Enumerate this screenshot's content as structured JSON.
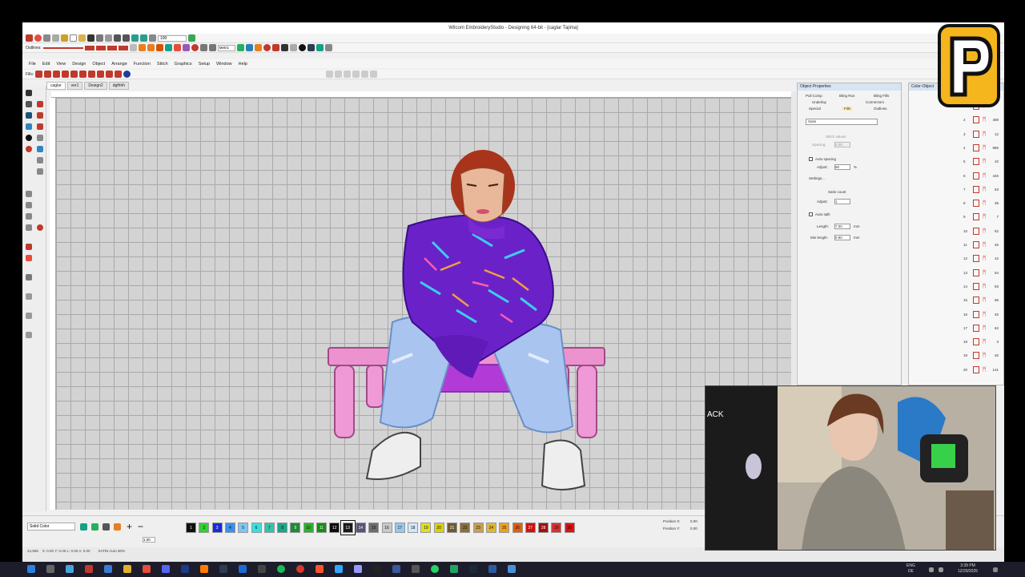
{
  "window": {
    "title": "Wilcom EmbroideryStudio - Designing 64-bit - [caglar     Tajima]"
  },
  "toolbar": {
    "outlines_label": "Outlines:",
    "fills_label": "Fills:",
    "metric_value": "Metric",
    "zoom_value": "100"
  },
  "menu": [
    "File",
    "Edit",
    "View",
    "Design",
    "Object",
    "Arrange",
    "Function",
    "Stitch",
    "Graphics",
    "Setup",
    "Window",
    "Help"
  ],
  "tabs": [
    "caglar",
    "ver1",
    "Design2",
    "dgfhhh"
  ],
  "object_properties": {
    "title": "Object Properties",
    "tabs_row1": [
      "Pull Comp",
      "Bling Run",
      "Bling Fills"
    ],
    "tabs_row2": [
      "Underlay",
      "Connectors"
    ],
    "tabs_row3": [
      "Special",
      "Fills",
      "Outlines"
    ],
    "fill_type": "Satin",
    "stitch_values_label": "Stitch values",
    "spacing_label": "Spacing:",
    "spacing_value": "0.38",
    "auto_spacing_label": "Auto spacing",
    "adjust_label": "Adjust:",
    "adjust_value": "90",
    "adjust_unit": "%",
    "settings_label": "Settings...",
    "satin_count_label": "Satin count",
    "satin_adjust_value": "1",
    "auto_split_label": "Auto split",
    "length_label": "Length:",
    "length_value": "7.00",
    "min_length_label": "Min length:",
    "min_length_value": "0.90",
    "unit_mm": "mm"
  },
  "color_object_list": {
    "title": "Color-Object",
    "rows": [
      {
        "n": "1",
        "count": ""
      },
      {
        "n": "2",
        "count": "488"
      },
      {
        "n": "3",
        "count": "12"
      },
      {
        "n": "4",
        "count": "986"
      },
      {
        "n": "5",
        "count": "10"
      },
      {
        "n": "6",
        "count": "445"
      },
      {
        "n": "7",
        "count": "63"
      },
      {
        "n": "8",
        "count": "35"
      },
      {
        "n": "9",
        "count": "7"
      },
      {
        "n": "10",
        "count": "62"
      },
      {
        "n": "11",
        "count": "46"
      },
      {
        "n": "12",
        "count": "42"
      },
      {
        "n": "13",
        "count": "54"
      },
      {
        "n": "14",
        "count": "83"
      },
      {
        "n": "15",
        "count": "96"
      },
      {
        "n": "16",
        "count": "40"
      },
      {
        "n": "17",
        "count": "62"
      },
      {
        "n": "18",
        "count": "3"
      },
      {
        "n": "19",
        "count": "40"
      },
      {
        "n": "20",
        "count": "141"
      }
    ]
  },
  "palette": {
    "mode_label": "Solid Color",
    "chips": [
      {
        "n": "1",
        "color": "#111111"
      },
      {
        "n": "2",
        "color": "#2fd12f"
      },
      {
        "n": "3",
        "color": "#1a2bd8"
      },
      {
        "n": "4",
        "color": "#3a8ff0"
      },
      {
        "n": "5",
        "color": "#7fc6f0"
      },
      {
        "n": "6",
        "color": "#39e0e0"
      },
      {
        "n": "7",
        "color": "#34c3a8"
      },
      {
        "n": "8",
        "color": "#1aa68b"
      },
      {
        "n": "9",
        "color": "#1f8a3a"
      },
      {
        "n": "10",
        "color": "#2bb12b"
      },
      {
        "n": "11",
        "color": "#148f14"
      },
      {
        "n": "12",
        "color": "#0c0c0c"
      },
      {
        "n": "13",
        "color": "#1a1a1a"
      },
      {
        "n": "14",
        "color": "#555577"
      },
      {
        "n": "15",
        "color": "#6d6d6d"
      },
      {
        "n": "16",
        "color": "#c9c9c9"
      },
      {
        "n": "17",
        "color": "#96c8f0"
      },
      {
        "n": "18",
        "color": "#d0e8f8"
      },
      {
        "n": "19",
        "color": "#e0e020"
      },
      {
        "n": "20",
        "color": "#d8d010"
      },
      {
        "n": "21",
        "color": "#6e5a32"
      },
      {
        "n": "22",
        "color": "#8c6e3c"
      },
      {
        "n": "23",
        "color": "#c8a050"
      },
      {
        "n": "24",
        "color": "#e0b830"
      },
      {
        "n": "25",
        "color": "#f0a020"
      },
      {
        "n": "26",
        "color": "#e06010"
      },
      {
        "n": "27",
        "color": "#d01010"
      },
      {
        "n": "28",
        "color": "#a01010"
      },
      {
        "n": "29",
        "color": "#d83030"
      },
      {
        "n": "30",
        "color": "#e01010"
      }
    ],
    "selected_chip": "13",
    "position_x_label": "Position X:",
    "position_y_label": "Position Y:",
    "position_x_value": "0.00",
    "position_y_value": "0.00",
    "size_value": "1.00"
  },
  "status": {
    "left": "24,959",
    "coords": "X: 0.00 Y: 0.00 L: 0.00 A: 0.00",
    "mode": "SATIN Auto 90%"
  },
  "taskbar": {
    "lang": "ENG",
    "region": "DE",
    "time": "3:39 PM",
    "date": "12/29/2025"
  },
  "colors": {
    "canvas_bg": "#d3d3d3",
    "taskbar": "#1c1c2a",
    "logo_yellow": "#f5b51d",
    "jacket_purple": "#6a22c8",
    "bench_pink": "#e888c8"
  }
}
